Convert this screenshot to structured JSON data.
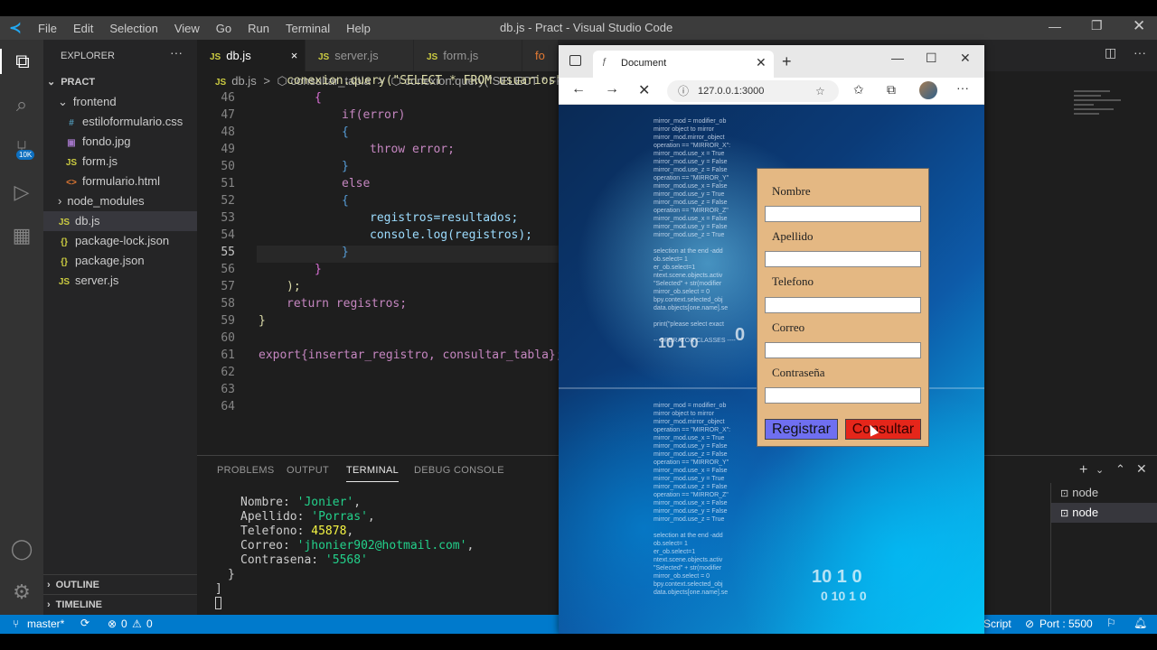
{
  "window": {
    "title": "db.js - Pract - Visual Studio Code"
  },
  "menu": [
    "File",
    "Edit",
    "Selection",
    "View",
    "Go",
    "Run",
    "Terminal",
    "Help"
  ],
  "activity": {
    "badge": "10K"
  },
  "explorer": {
    "header": "EXPLORER",
    "project": "PRACT",
    "items": [
      {
        "label": "frontend",
        "icon": "chevron-down-icon"
      },
      {
        "label": "estiloformulario.css",
        "icon": "#"
      },
      {
        "label": "fondo.jpg",
        "icon": "image-icon"
      },
      {
        "label": "form.js",
        "icon": "JS"
      },
      {
        "label": "formulario.html",
        "icon": "<>"
      },
      {
        "label": "node_modules",
        "icon": "chevron-right-icon"
      },
      {
        "label": "db.js",
        "icon": "JS"
      },
      {
        "label": "package-lock.json",
        "icon": "{}"
      },
      {
        "label": "package.json",
        "icon": "{}"
      },
      {
        "label": "server.js",
        "icon": "JS"
      }
    ],
    "outline": "OUTLINE",
    "timeline": "TIMELINE"
  },
  "tabs": [
    {
      "label": "db.js",
      "close": "×"
    },
    {
      "label": "server.js"
    },
    {
      "label": "form.js"
    },
    {
      "label": "fo"
    }
  ],
  "breadcrumb": {
    "file": "db.js",
    "sep": ">",
    "fn": "consultar_tabla",
    "call": "conexion.query(\"SELECT * FROM"
  },
  "code": {
    "line_numbers": [
      "46",
      "47",
      "48",
      "49",
      "50",
      "51",
      "52",
      "53",
      "54",
      "55",
      "56",
      "57",
      "58",
      "59",
      "60",
      "61",
      "62",
      "63",
      "64"
    ],
    "lines": [
      "conexion.query(\"SELECT * FROM usuarios\"",
      "{",
      "if(error)",
      "{",
      "throw error;",
      "}",
      "else",
      "{",
      "registros=resultados;",
      "console.log(registros);",
      "}",
      "}",
      ");",
      "return registros;",
      "}",
      "",
      "export{insertar_registro, consultar_tabla};",
      "",
      ""
    ]
  },
  "panel": {
    "tabs": [
      "PROBLEMS",
      "OUTPUT",
      "TERMINAL",
      "DEBUG CONSOLE"
    ],
    "terminal_lines": [
      {
        "key": "Nombre: ",
        "val": "'Jonier'",
        "end": ","
      },
      {
        "key": "Apellido: ",
        "val": "'Porras'",
        "end": ","
      },
      {
        "key": "Telefono: ",
        "val": "45878",
        "end": ","
      },
      {
        "key": "Correo: ",
        "val": "'jhonier902@hotmail.com'",
        "end": ","
      },
      {
        "key": "Contrasena: ",
        "val": "'5568'",
        "end": ""
      }
    ],
    "terminal_close": "}",
    "terminal_bracket": "]",
    "terminals": [
      "node",
      "node"
    ]
  },
  "statusbar": {
    "branch": "master*",
    "errors": "0",
    "warnings": "0",
    "lang": "Script",
    "port": "Port : 5500"
  },
  "browser": {
    "tab_title": "Document",
    "url": "127.0.0.1:3000",
    "form": {
      "labels": [
        "Nombre",
        "Apellido",
        "Telefono",
        "Correo",
        "Contraseña"
      ],
      "register_button": "Registrar",
      "query_button": "Consultar"
    },
    "bg_digits": [
      "0",
      "10 1 0",
      "10 1 0",
      "0 10 1 0"
    ]
  }
}
